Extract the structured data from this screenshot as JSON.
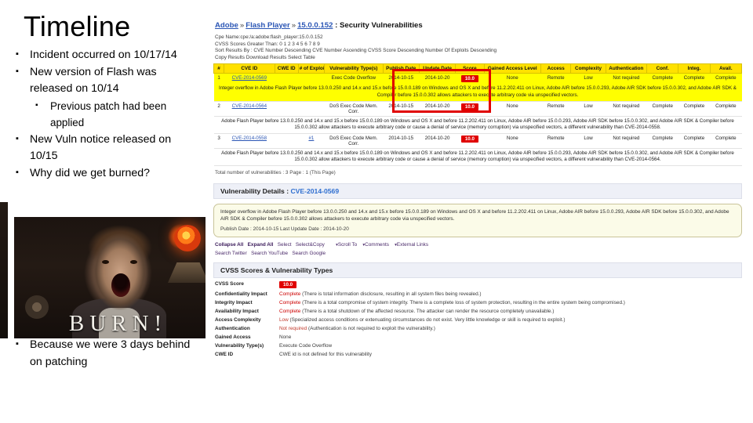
{
  "slide": {
    "title": "Timeline",
    "bullets_top": [
      {
        "level": 1,
        "text": "Incident occurred on 10/17/14"
      },
      {
        "level": 1,
        "text": "New version of Flash was released on 10/14"
      },
      {
        "level": 2,
        "text": "Previous patch had been applied"
      },
      {
        "level": 1,
        "text": "New Vuln notice released on 10/15"
      },
      {
        "level": 1,
        "text": "Why did we get burned?"
      }
    ],
    "image": {
      "caption": "BURN!",
      "alt_name": "burn-meme-photo"
    },
    "bullets_bottom": [
      {
        "level": 1,
        "text": "Because we were 3 days behind on patching"
      }
    ]
  },
  "screenshot": {
    "breadcrumb": {
      "vendor": "Adobe",
      "product": "Flash Player",
      "version": "15.0.0.152",
      "suffix": ": Security Vulnerabilities",
      "separator": "»"
    },
    "meta": {
      "cpe_line": "Cpe Name:cpe:/a:adobe:flash_player:15.0.0.152",
      "cvss_line": "CVSS Scores Greater Than: 0  1  2  3  4  5  6  7  8  9",
      "sort_line": "Sort Results By : CVE Number Descending   CVE Number Ascending   CVSS Score Descending   Number Of Exploits Descending",
      "copy_line": "Copy Results Download Results Select Table"
    },
    "table": {
      "headers": [
        "#",
        "CVE ID",
        "CWE ID",
        "# of Exploits",
        "Vulnerability Type(s)",
        "Publish Date",
        "Update Date",
        "Score",
        "Gained Access Level",
        "Access",
        "Complexity",
        "Authentication",
        "Conf.",
        "Integ.",
        "Avail."
      ],
      "rows": [
        {
          "num": "1",
          "cve": "CVE-2014-0569",
          "cwe": "",
          "exploits": "",
          "vuln_types": "Exec Code Overflow",
          "publish": "2014-10-15",
          "update": "2014-10-20",
          "score": "10.0",
          "gained": "None",
          "access": "Remote",
          "complexity": "Low",
          "auth": "Not required",
          "conf": "Complete",
          "integ": "Complete",
          "avail": "Complete",
          "highlight": true,
          "description": "Integer overflow in Adobe Flash Player before 13.0.0.250 and 14.x and 15.x before 15.0.0.189 on Windows and OS X and before 11.2.202.411 on Linux, Adobe AIR before 15.0.0.293, Adobe AIR SDK before 15.0.0.302, and Adobe AIR SDK & Compiler before 15.0.0.302 allows attackers to execute arbitrary code via unspecified vectors."
        },
        {
          "num": "2",
          "cve": "CVE-2014-0564",
          "cwe": "",
          "exploits": "",
          "vuln_types": "DoS Exec Code Mem. Corr.",
          "publish": "2014-10-15",
          "update": "2014-10-20",
          "score": "10.0",
          "gained": "None",
          "access": "Remote",
          "complexity": "Low",
          "auth": "Not required",
          "conf": "Complete",
          "integ": "Complete",
          "avail": "Complete",
          "highlight": false,
          "description": "Adobe Flash Player before 13.0.0.250 and 14.x and 15.x before 15.0.0.189 on Windows and OS X and before 11.2.202.411 on Linux, Adobe AIR before 15.0.0.293, Adobe AIR SDK before 15.0.0.302, and Adobe AIR SDK & Compiler before 15.0.0.302 allow attackers to execute arbitrary code or cause a denial of service (memory corruption) via unspecified vectors, a different vulnerability than CVE-2014-0558."
        },
        {
          "num": "3",
          "cve": "CVE-2014-0558",
          "cwe": "",
          "exploits": "#1",
          "vuln_types": "DoS Exec Code Mem. Corr.",
          "publish": "2014-10-15",
          "update": "2014-10-20",
          "score": "10.0",
          "gained": "None",
          "access": "Remote",
          "complexity": "Low",
          "auth": "Not required",
          "conf": "Complete",
          "integ": "Complete",
          "avail": "Complete",
          "highlight": false,
          "description": "Adobe Flash Player before 13.0.0.250 and 14.x and 15.x before 15.0.0.189 on Windows and OS X and before 11.2.202.411 on Linux, Adobe AIR before 15.0.0.293, Adobe AIR SDK before 15.0.0.302, and Adobe AIR SDK & Compiler before 15.0.0.302 allow attackers to execute arbitrary code or cause a denial of service (memory corruption) via unspecified vectors, a different vulnerability than CVE-2014-0564."
        }
      ],
      "totals": "Total number of vulnerabilities : 3   Page : 1 (This Page)"
    },
    "details": {
      "section_title": "Vulnerability Details :",
      "section_cve": "CVE-2014-0569",
      "description": "Integer overflow in Adobe Flash Player before 13.0.0.250 and 14.x and 15.x before 15.0.0.189 on Windows and OS X and before 11.2.202.411 on Linux, Adobe AIR before 15.0.0.293, Adobe AIR SDK before 15.0.0.302, and Adobe AIR SDK & Compiler before 15.0.0.302 allows attackers to execute arbitrary code via unspecified vectors.",
      "publish_label": "Publish Date : 2014-10-15 Last Update Date : 2014-10-20"
    },
    "tools": {
      "row1": [
        "Collapse All",
        "Expand All",
        "Select",
        "Select&Copy"
      ],
      "row1_dropdowns": [
        "Scroll To",
        "Comments",
        "External Links"
      ],
      "row2": [
        "Search Twitter",
        "Search YouTube",
        "Search Google"
      ]
    },
    "cvss": {
      "title": "CVSS Scores & Vulnerability Types",
      "rows": [
        {
          "label": "CVSS Score",
          "value": "10.0",
          "badge": true
        },
        {
          "label": "Confidentiality Impact",
          "value": "Complete",
          "note": "(There is total information disclosure, resulting in all system files being revealed.)"
        },
        {
          "label": "Integrity Impact",
          "value": "Complete",
          "note": "(There is a total compromise of system integrity. There is a complete loss of system protection, resulting in the entire system being compromised.)"
        },
        {
          "label": "Availability Impact",
          "value": "Complete",
          "note": "(There is a total shutdown of the affected resource. The attacker can render the resource completely unavailable.)"
        },
        {
          "label": "Access Complexity",
          "value": "Low",
          "note": "(Specialized access conditions or extenuating circumstances do not exist. Very little knowledge or skill is required to exploit.)"
        },
        {
          "label": "Authentication",
          "value": "Not required",
          "note": "(Authentication is not required to exploit the vulnerability.)"
        },
        {
          "label": "Gained Access",
          "value": "None",
          "note": ""
        },
        {
          "label": "Vulnerability Type(s)",
          "value": "Execute Code Overflow",
          "note": ""
        },
        {
          "label": "CWE ID",
          "value": "CWE id is not defined for this vulnerability",
          "note": ""
        }
      ]
    },
    "annotation": {
      "shape": "red-rectangle",
      "color": "#e00000"
    }
  }
}
